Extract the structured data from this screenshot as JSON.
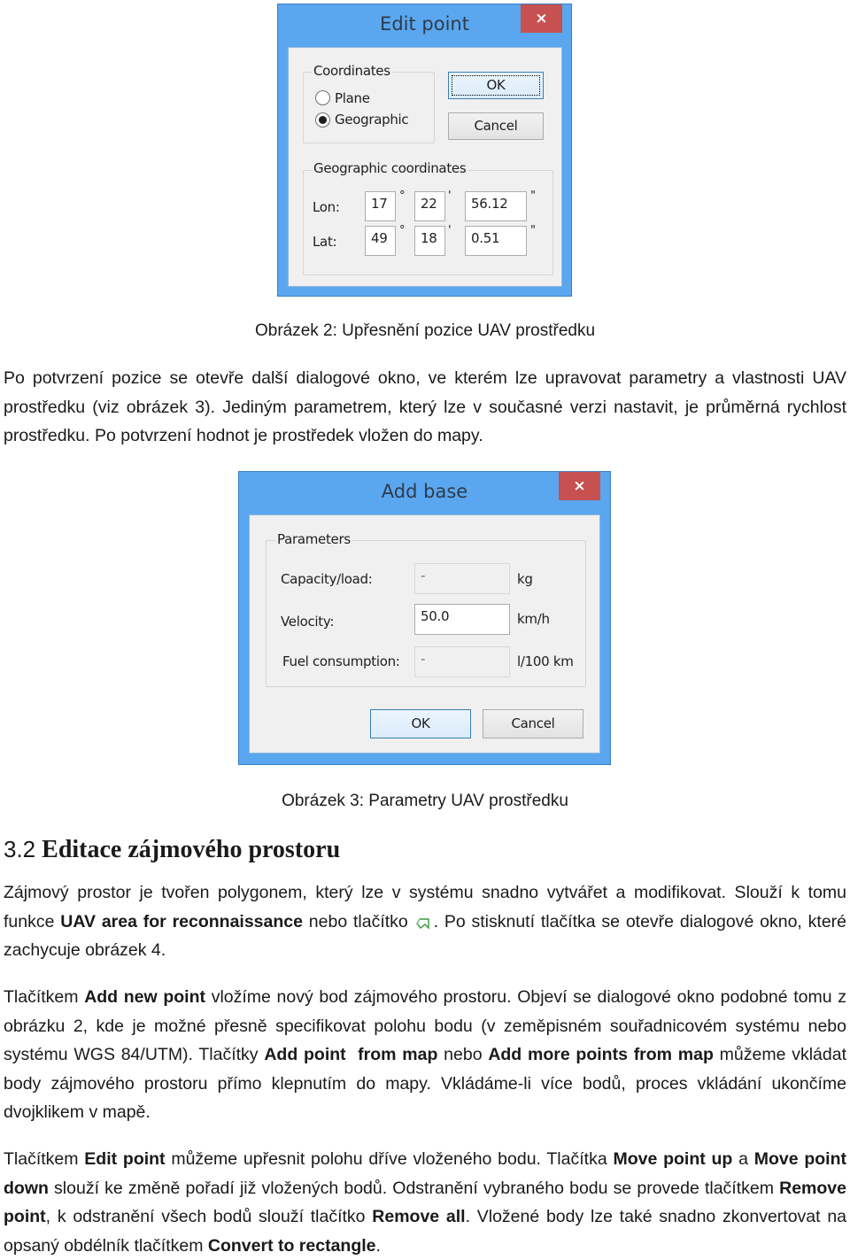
{
  "edit_point_dialog": {
    "title": "Edit point",
    "close_icon": "×",
    "coordinates_group": {
      "label": "Coordinates",
      "options": [
        {
          "label": "Plane",
          "selected": false
        },
        {
          "label": "Geographic",
          "selected": true
        }
      ]
    },
    "ok_label": "OK",
    "cancel_label": "Cancel",
    "geo_group": {
      "label": "Geographic coordinates",
      "lon_label": "Lon:",
      "lat_label": "Lat:",
      "lon": {
        "deg": "17",
        "min": "22",
        "sec": "56.12"
      },
      "lat": {
        "deg": "49",
        "min": "18",
        "sec": "0.51"
      },
      "deg_symbol": "°",
      "min_symbol": "'",
      "sec_symbol": "\""
    }
  },
  "caption_2": "Obrázek 2: Upřesnění pozice UAV prostředku",
  "paragraph_1": "Po potvrzení pozice se otevře další dialogové okno, ve kterém lze upravovat parametry a vlastnosti UAV prostředku (viz obrázek 3). Jediným parametrem, který lze v současné verzi nastavit, je průměrná rychlost prostředku. Po potvrzení hodnot je prostředek vložen do mapy.",
  "add_base_dialog": {
    "title": "Add base",
    "close_icon": "×",
    "parameters_group": {
      "label": "Parameters",
      "fields": [
        {
          "label": "Capacity/load:",
          "value": "-",
          "unit": "kg",
          "enabled": false
        },
        {
          "label": "Velocity:",
          "value": "50.0",
          "unit": "km/h",
          "enabled": true
        },
        {
          "label": "Fuel consumption:",
          "value": "-",
          "unit": "l/100 km",
          "enabled": false
        }
      ]
    },
    "ok_label": "OK",
    "cancel_label": "Cancel"
  },
  "caption_3": "Obrázek 3: Parametry UAV prostředku",
  "section": {
    "number": "3.2",
    "title": "Editace zájmového prostoru"
  },
  "paragraph_2": {
    "t1": "Zájmový prostor je tvořen polygonem, který lze v systému snadno vytvářet a modifikovat. Slouží k tomu funkce ",
    "b1": "UAV area for reconnaissance",
    "t2": " nebo tlačítko ",
    "icon": "polygon-area-icon",
    "t3": ". Po stisknutí tlačítka se otevře dialogové okno, které zachycuje obrázek 4."
  },
  "paragraph_3": {
    "t1": "Tlačítkem ",
    "b1": "Add new point",
    "t2": " vložíme nový bod zájmového prostoru. Objeví se dialogové okno podobné tomu z obrázku 2, kde je možné přesně specifikovat polohu bodu (v zeměpisném souřadnicovém systému nebo systému WGS 84/UTM). Tlačítky ",
    "b2": "Add point  from map",
    "t3": " nebo ",
    "b3": "Add more points from map",
    "t4": " můžeme vkládat body zájmového prostoru přímo klepnutím do mapy. Vkládáme-li více bodů, proces vkládání ukončíme dvojklikem v mapě."
  },
  "paragraph_4": {
    "t1": "Tlačítkem ",
    "b1": "Edit point",
    "t2": " můžeme upřesnit polohu dříve vloženého bodu. Tlačítka ",
    "b2": "Move point up",
    "t3": " a ",
    "b3": "Move point down",
    "t4": " slouží ke změně pořadí již vložených bodů. Odstranění vybraného bodu se provede tlačítkem ",
    "b4": "Remove point",
    "t5": ", k odstranění všech bodů slouží tlačítko ",
    "b5": "Remove all",
    "t6": ". Vložené body lze také snadno zkonvertovat na opsaný obdélník tlačítkem ",
    "b6": "Convert to rectangle",
    "t7": "."
  }
}
